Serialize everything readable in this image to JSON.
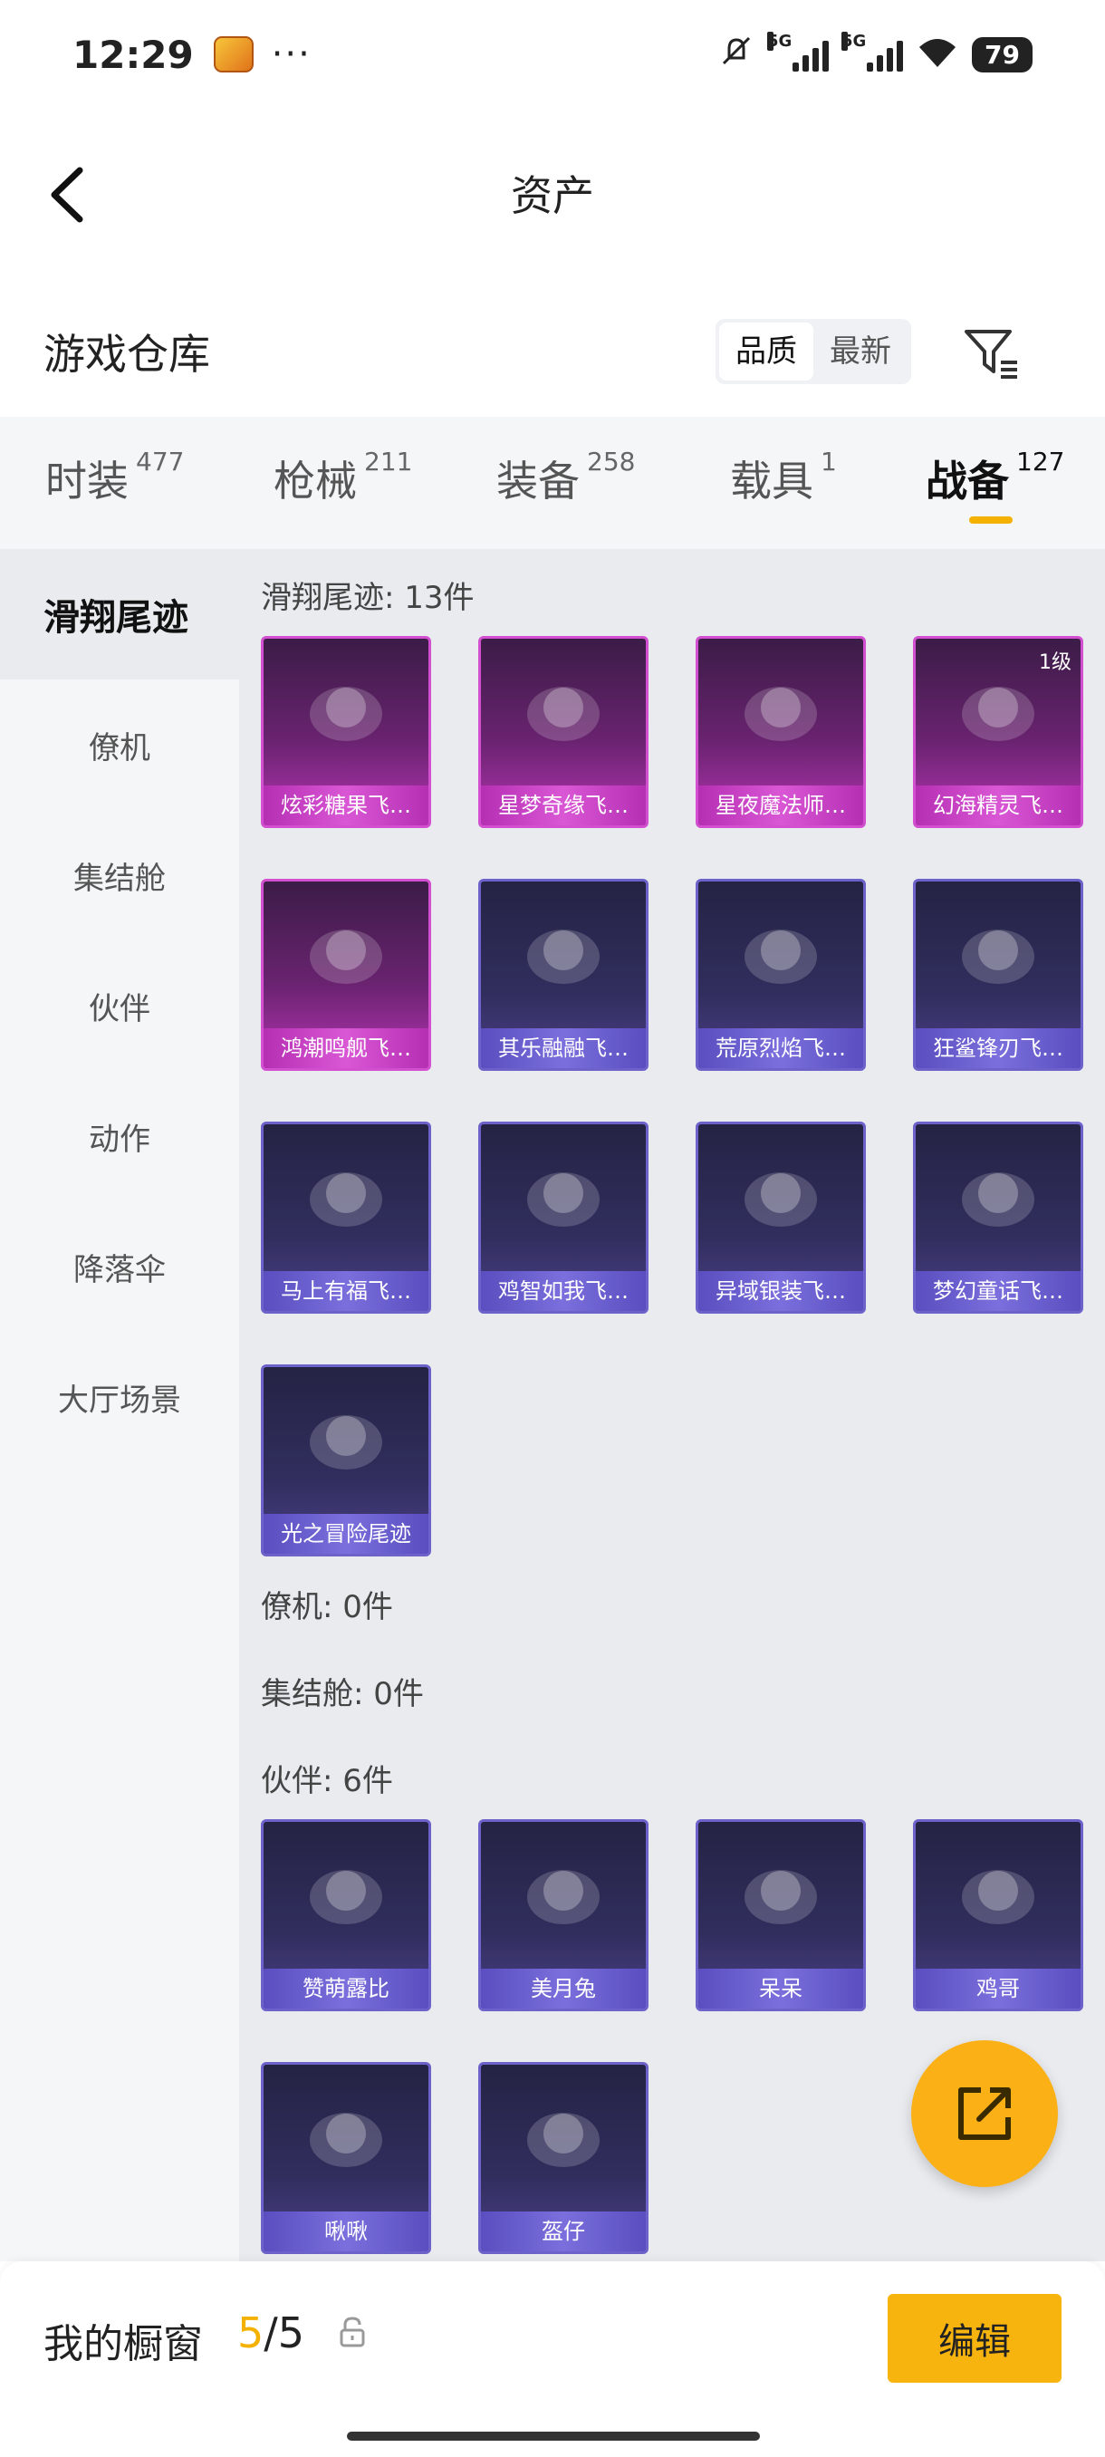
{
  "status_bar": {
    "time": "12:29",
    "more": "···",
    "net1": "5G",
    "net2": "5G",
    "battery": "79"
  },
  "header": {
    "title": "资产"
  },
  "warehouse": {
    "title": "游戏仓库",
    "sort_options": [
      "品质",
      "最新"
    ],
    "sort_selected": "品质"
  },
  "categories": [
    {
      "label": "时装",
      "count": "477"
    },
    {
      "label": "枪械",
      "count": "211"
    },
    {
      "label": "装备",
      "count": "258"
    },
    {
      "label": "载具",
      "count": "1"
    },
    {
      "label": "战备",
      "count": "127"
    }
  ],
  "active_category": "战备",
  "sidebar": {
    "items": [
      "滑翔尾迹",
      "僚机",
      "集结舱",
      "伙伴",
      "动作",
      "降落伞",
      "大厅场景"
    ],
    "active": "滑翔尾迹"
  },
  "sections": {
    "glide": {
      "title": "滑翔尾迹: 13件",
      "items": [
        {
          "name": "炫彩糖果飞…",
          "rarity": "purple"
        },
        {
          "name": "星梦奇缘飞…",
          "rarity": "purple"
        },
        {
          "name": "星夜魔法师…",
          "rarity": "purple"
        },
        {
          "name": "幻海精灵飞…",
          "rarity": "purple",
          "level": "1级"
        },
        {
          "name": "鸿潮鸣舰飞…",
          "rarity": "purple"
        },
        {
          "name": "其乐融融飞…",
          "rarity": "blue"
        },
        {
          "name": "荒原烈焰飞…",
          "rarity": "blue"
        },
        {
          "name": "狂鲨锋刃飞…",
          "rarity": "blue"
        },
        {
          "name": "马上有福飞…",
          "rarity": "blue"
        },
        {
          "name": "鸡智如我飞…",
          "rarity": "blue"
        },
        {
          "name": "异域银装飞…",
          "rarity": "blue"
        },
        {
          "name": "梦幻童话飞…",
          "rarity": "blue"
        },
        {
          "name": "光之冒险尾迹",
          "rarity": "blue"
        }
      ]
    },
    "wingman": {
      "title": "僚机: 0件"
    },
    "capsule": {
      "title": "集结舱: 0件"
    },
    "partner": {
      "title": "伙伴: 6件",
      "items": [
        {
          "name": "赞萌露比",
          "rarity": "blue"
        },
        {
          "name": "美月兔",
          "rarity": "blue"
        },
        {
          "name": "呆呆",
          "rarity": "blue"
        },
        {
          "name": "鸡哥",
          "rarity": "blue"
        },
        {
          "name": "啾啾",
          "rarity": "blue"
        },
        {
          "name": "盔仔",
          "rarity": "blue"
        }
      ]
    }
  },
  "bottom": {
    "label": "我的橱窗",
    "used": "5",
    "slash_total": "/5",
    "edit_label": "编辑"
  },
  "colors": {
    "accent": "#f5b100",
    "purple_rarity": "#b534b3",
    "blue_rarity": "#6d62c9"
  },
  "icons": [
    "back-arrow-icon",
    "filter-icon",
    "lock-icon",
    "share-icon"
  ]
}
